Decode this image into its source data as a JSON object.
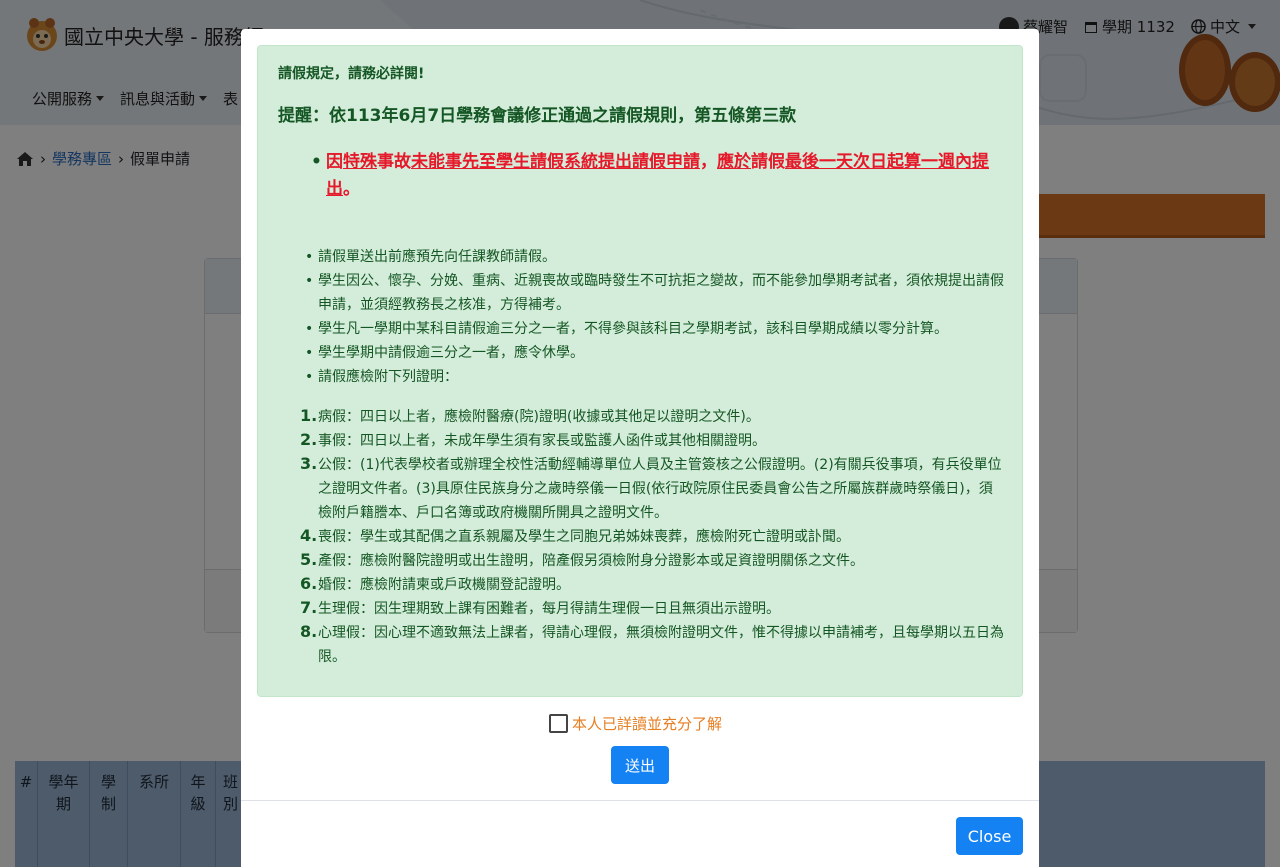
{
  "header": {
    "title": "國立中央大學 - 服務網",
    "user_name": "蔡耀智",
    "semester": "學期 1132",
    "language": "中文"
  },
  "nav": {
    "items": [
      {
        "label": "公開服務"
      },
      {
        "label": "訊息與活動"
      },
      {
        "label": "表"
      }
    ]
  },
  "breadcrumb": {
    "section": "學務專區",
    "current": "假單申請"
  },
  "table": {
    "headers": [
      "#",
      "學年期",
      "學制",
      "系所",
      "年級",
      "班別"
    ]
  },
  "modal": {
    "notice_heading": "請假規定，請務必詳閱!",
    "reminder": "提醒：依113年6月7日學務會議修正通過之請假規則，第五條第三款",
    "key_rule": {
      "p1": "因",
      "p2": "特殊",
      "p3": "事故",
      "p4": "未能事先至學生請假系統提出請假申請",
      "p5": "，",
      "p6": "應於",
      "p7": "請假",
      "p8": "最後一天次日起算一週內提出",
      "p9": "。"
    },
    "rules": [
      "請假單送出前應預先向任課教師請假。",
      "學生因公、懷孕、分娩、重病、近親喪故或臨時發生不可抗拒之變故，而不能參加學期考試者，須依規提出請假申請，並須經教務長之核准，方得補考。",
      "學生凡一學期中某科目請假逾三分之一者，不得參與該科目之學期考試，該科目學期成績以零分計算。",
      "學生學期中請假逾三分之一者，應令休學。",
      "請假應檢附下列證明："
    ],
    "certificates": [
      {
        "num": "1.",
        "text": "病假：四日以上者，應檢附醫療(院)證明(收據或其他足以證明之文件)。"
      },
      {
        "num": "2.",
        "text": "事假：四日以上者，未成年學生須有家長或監護人函件或其他相關證明。"
      },
      {
        "num": "3.",
        "text": "公假：(1)代表學校者或辦理全校性活動經輔導單位人員及主管簽核之公假證明。(2)有關兵役事項，有兵役單位之證明文件者。(3)具原住民族身分之歲時祭儀一日假(依行政院原住民委員會公告之所屬族群歲時祭儀日)，須檢附戶籍謄本、戶口名簿或政府機關所開具之證明文件。"
      },
      {
        "num": "4.",
        "text": "喪假：學生或其配偶之直系親屬及學生之同胞兄弟姊妹喪葬，應檢附死亡證明或訃聞。"
      },
      {
        "num": "5.",
        "text": "產假：應檢附醫院證明或出生證明，陪產假另須檢附身分證影本或足資證明關係之文件。"
      },
      {
        "num": "6.",
        "text": "婚假：應檢附請柬或戶政機關登記證明。"
      },
      {
        "num": "7.",
        "text": "生理假：因生理期致上課有困難者，每月得請生理假一日且無須出示證明。"
      },
      {
        "num": "8.",
        "text": "心理假：因心理不適致無法上課者，得請心理假，無須檢附證明文件，惟不得據以申請補考，且每學期以五日為限。"
      }
    ],
    "acknowledge_label": "本人已詳讀並充分了解",
    "acknowledge_checked": false,
    "submit_label": "送出",
    "close_label": "Close"
  }
}
